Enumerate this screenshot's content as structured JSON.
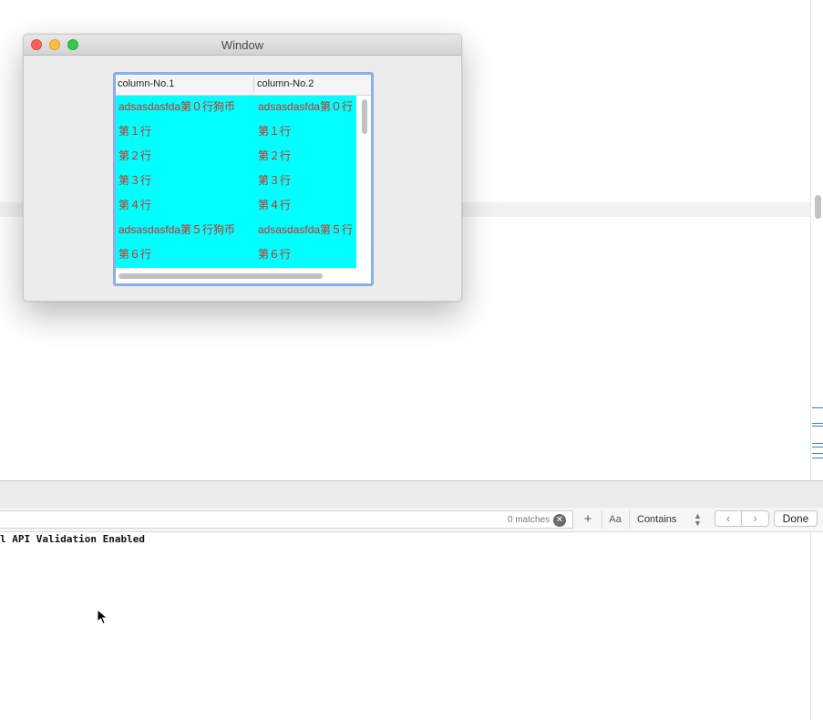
{
  "window": {
    "title": "Window"
  },
  "table": {
    "columns": [
      "column-No.1",
      "column-No.2"
    ],
    "rows": [
      [
        "adsasdasfda第０行狗币",
        "adsasdasfda第０行"
      ],
      [
        "第１行",
        "第１行"
      ],
      [
        "第２行",
        "第２行"
      ],
      [
        "第３行",
        "第３行"
      ],
      [
        "第４行",
        "第４行"
      ],
      [
        "adsasdasfda第５行狗币",
        "adsasdasfda第５行"
      ],
      [
        "第６行",
        "第６行"
      ]
    ],
    "row_background": "#00ffff",
    "cell_text_color": "#d12b1f"
  },
  "find_bar": {
    "matches": "0 matches",
    "case_button": "Aa",
    "mode": "Contains",
    "done": "Done"
  },
  "console": {
    "line": "l API Validation Enabled"
  },
  "colors": {
    "focus_ring": "#8aaeee",
    "close": "#fc605c",
    "minimize": "#fdbc40",
    "maximize": "#34c84a"
  }
}
